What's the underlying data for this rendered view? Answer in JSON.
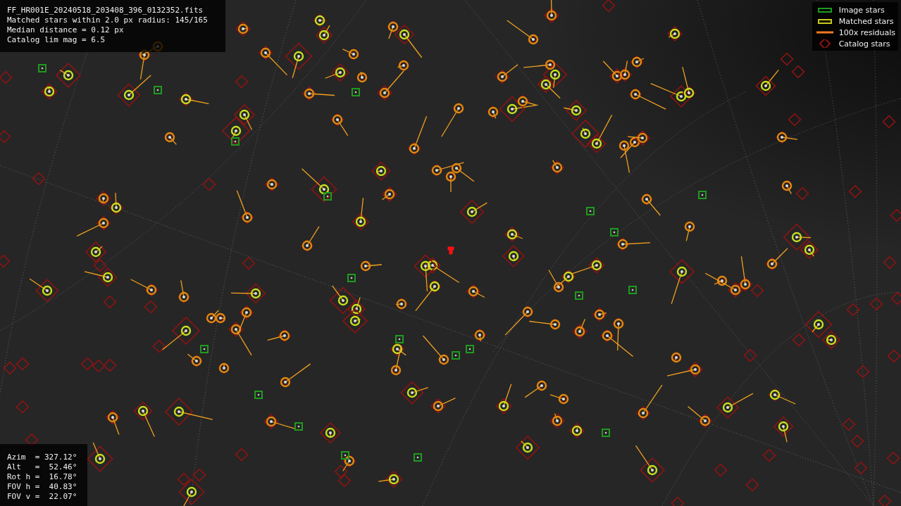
{
  "info_panel": {
    "lines": [
      "FF_HR001E_20240518_203408_396_0132352.fits",
      "Matched stars within 2.0 px radius: 145/165",
      "Median distance = 0.12 px",
      "Catalog lim mag = 6.5"
    ]
  },
  "legend": [
    {
      "kind": "box",
      "label": "Image stars",
      "color": "#1f9a1f"
    },
    {
      "kind": "box",
      "label": "Matched stars",
      "color": "#c8c81e"
    },
    {
      "kind": "line",
      "label": "100x residuals",
      "color": "#f07820"
    },
    {
      "kind": "diamond",
      "label": "Catalog stars",
      "color": "#8c1414"
    }
  ],
  "pointing_panel": {
    "lines": [
      "Azim  = 327.12°",
      "Alt   =  52.46°",
      "Rot h =  16.78°",
      "FOV h =  40.83°",
      "FOV v =  22.07°"
    ]
  }
}
